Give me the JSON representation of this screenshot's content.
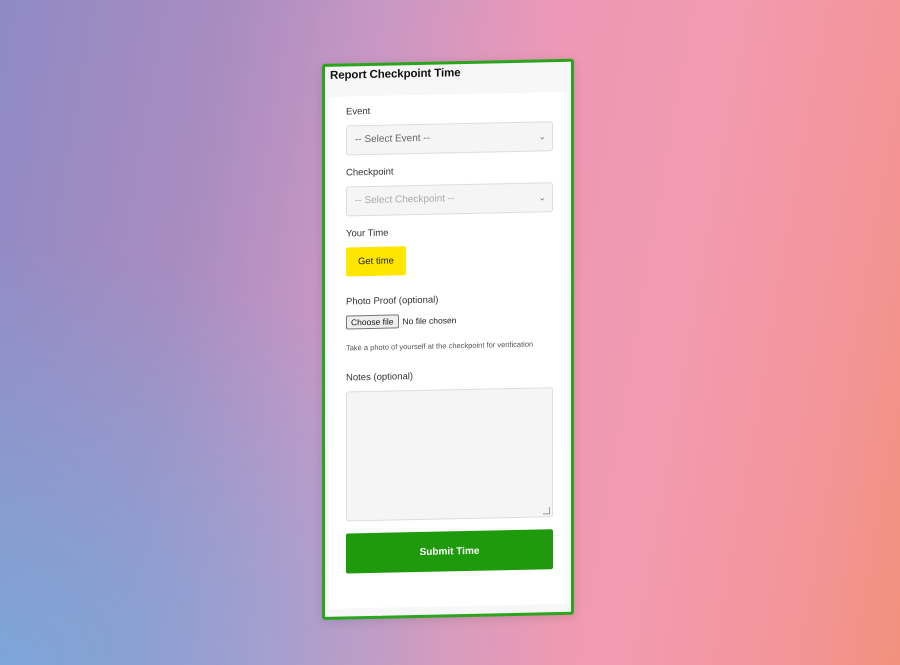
{
  "form": {
    "title": "Report Checkpoint Time",
    "event_label": "Event",
    "event_placeholder": "-- Select Event --",
    "checkpoint_label": "Checkpoint",
    "checkpoint_placeholder": "-- Select Checkpoint --",
    "time_label": "Your Time",
    "get_time_label": "Get time",
    "photo_label": "Photo Proof (optional)",
    "choose_file_label": "Choose file",
    "no_file_text": "No file chosen",
    "photo_hint": "Take a photo of yourself at the checkpoint for verification",
    "notes_label": "Notes (optional)",
    "notes_value": "",
    "submit_label": "Submit Time"
  },
  "colors": {
    "border": "#2aa51d",
    "get_time_button": "#ffe600",
    "submit_button": "#1e9a0c"
  },
  "icons": {
    "select_chevron": "chevron-down-icon"
  }
}
